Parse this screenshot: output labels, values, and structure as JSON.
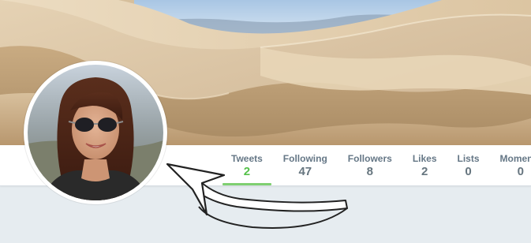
{
  "profile_nav": {
    "stats": [
      {
        "label": "Tweets",
        "value": "2",
        "active": true
      },
      {
        "label": "Following",
        "value": "47",
        "active": false
      },
      {
        "label": "Followers",
        "value": "8",
        "active": false
      },
      {
        "label": "Likes",
        "value": "2",
        "active": false
      },
      {
        "label": "Lists",
        "value": "0",
        "active": false
      },
      {
        "label": "Moments",
        "value": "0",
        "active": false
      }
    ]
  },
  "colors": {
    "accent": "#7fcf71",
    "active_value": "#55c14a",
    "label": "#657786",
    "page_background": "#e6ecf0"
  },
  "icons": {
    "annotation_arrow": "curved-arrow-icon"
  }
}
